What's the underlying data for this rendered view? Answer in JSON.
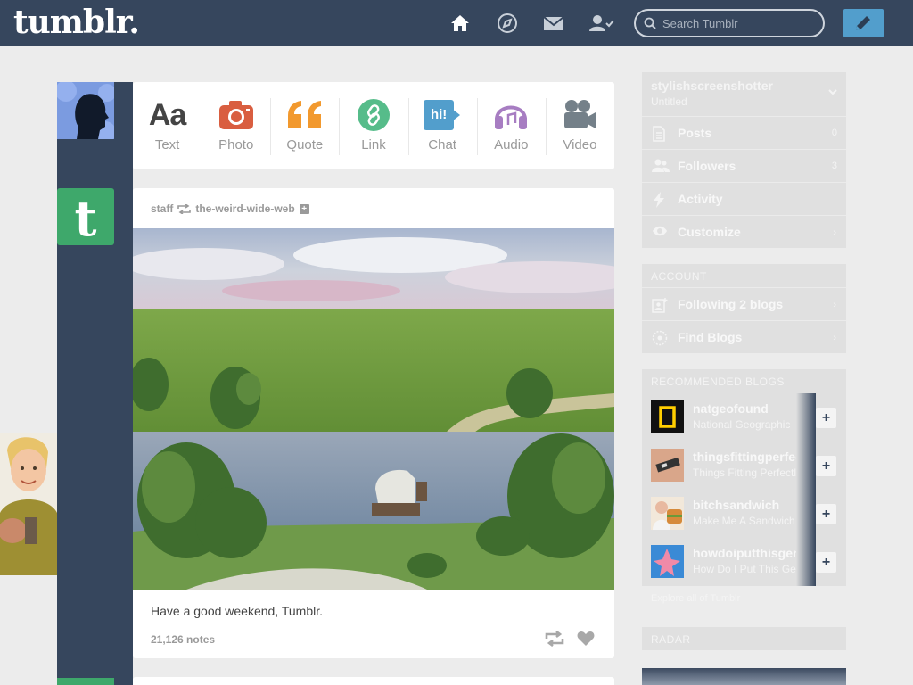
{
  "header": {
    "logo": "tumblr.",
    "search_placeholder": "Search Tumblr",
    "colors": {
      "bar": "#36465d",
      "compose": "#529ecc"
    }
  },
  "composer": {
    "types": [
      {
        "label": "Text",
        "icon": "text-icon",
        "glyph": "Aa",
        "color": "#444444"
      },
      {
        "label": "Photo",
        "icon": "camera-icon",
        "color": "#d95e40"
      },
      {
        "label": "Quote",
        "icon": "quote-icon",
        "glyph": "“",
        "color": "#f2992e"
      },
      {
        "label": "Link",
        "icon": "link-icon",
        "color": "#56bc8a"
      },
      {
        "label": "Chat",
        "icon": "chat-icon",
        "glyph": "hi!",
        "color": "#529ecc"
      },
      {
        "label": "Audio",
        "icon": "headphones-icon",
        "color": "#a77dc2"
      },
      {
        "label": "Video",
        "icon": "video-camera-icon",
        "color": "#748089"
      }
    ]
  },
  "post": {
    "author": "staff",
    "reblogged_from": "the-weird-wide-web",
    "caption": "Have a good weekend, Tumblr.",
    "notes": "21,126 notes"
  },
  "sidebar": {
    "blog": {
      "name": "stylishscreenshotter",
      "title": "Untitled"
    },
    "menu": [
      {
        "label": "Posts",
        "count": "0",
        "icon": "posts-icon"
      },
      {
        "label": "Followers",
        "count": "3",
        "icon": "followers-icon"
      },
      {
        "label": "Activity",
        "icon": "activity-icon"
      },
      {
        "label": "Customize",
        "icon": "eye-icon"
      }
    ],
    "account_title": "ACCOUNT",
    "account": [
      {
        "label": "Following 2 blogs",
        "icon": "following-icon"
      },
      {
        "label": "Find Blogs",
        "icon": "find-blogs-icon"
      }
    ],
    "recommended_title": "RECOMMENDED BLOGS",
    "recommended": [
      {
        "name": "natgeofound",
        "title": "National Geographic"
      },
      {
        "name": "thingsfittingperfectly",
        "title": "Things Fitting Perfectly"
      },
      {
        "name": "bitchsandwich",
        "title": "Make Me A Sandwich"
      },
      {
        "name": "howdoiputthisgently",
        "title": "How Do I Put This Gently"
      }
    ],
    "explore": "Explore all of Tumblr",
    "radar_title": "RADAR"
  }
}
